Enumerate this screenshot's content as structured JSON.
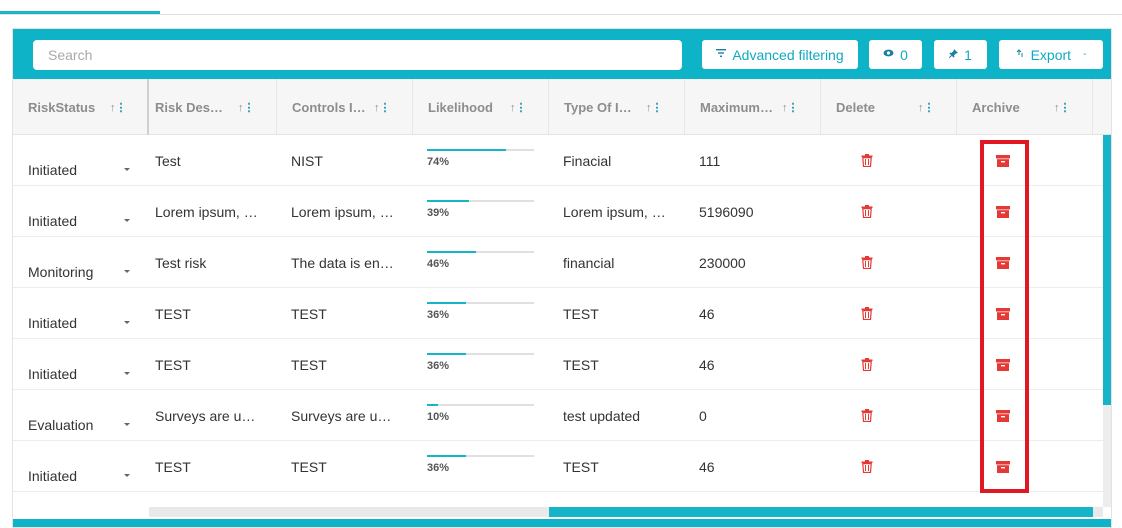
{
  "search": {
    "placeholder": "Search",
    "value": ""
  },
  "toolbar": {
    "advanced_filtering": "Advanced filtering",
    "visible_count": "0",
    "pinned_count": "1",
    "export_label": "Export",
    "icons": {
      "filter": "filter-icon",
      "eye": "eye-icon",
      "pin": "pin-icon",
      "export": "export-icon",
      "dropdown": "chevron-down-icon"
    }
  },
  "columns": [
    {
      "label": "RiskStatus"
    },
    {
      "label": "Risk Des…"
    },
    {
      "label": "Controls I…"
    },
    {
      "label": "Likelihood"
    },
    {
      "label": "Type Of I…"
    },
    {
      "label": "Maximum…"
    },
    {
      "label": "Delete"
    },
    {
      "label": "Archive"
    }
  ],
  "rows": [
    {
      "status": "Initiated",
      "description": "Test",
      "controls": "NIST",
      "likelihood": 74,
      "likelihood_label": "74%",
      "type": "Finacial",
      "maximum": "111"
    },
    {
      "status": "Initiated",
      "description": "Lorem ipsum, …",
      "controls": "Lorem ipsum, …",
      "likelihood": 39,
      "likelihood_label": "39%",
      "type": "Lorem ipsum, …",
      "maximum": "5196090"
    },
    {
      "status": "Monitoring",
      "description": "Test risk",
      "controls": "The data is en…",
      "likelihood": 46,
      "likelihood_label": "46%",
      "type": "financial",
      "maximum": "230000"
    },
    {
      "status": "Initiated",
      "description": "TEST",
      "controls": "TEST",
      "likelihood": 36,
      "likelihood_label": "36%",
      "type": "TEST",
      "maximum": "46"
    },
    {
      "status": "Initiated",
      "description": "TEST",
      "controls": "TEST",
      "likelihood": 36,
      "likelihood_label": "36%",
      "type": "TEST",
      "maximum": "46"
    },
    {
      "status": "Evaluation",
      "description": "Surveys are u…",
      "controls": "Surveys are u…",
      "likelihood": 10,
      "likelihood_label": "10%",
      "type": "test updated",
      "maximum": "0"
    },
    {
      "status": "Initiated",
      "description": "TEST",
      "controls": "TEST",
      "likelihood": 36,
      "likelihood_label": "36%",
      "type": "TEST",
      "maximum": "46"
    }
  ],
  "colors": {
    "accent": "#0eb3c7",
    "danger": "#e53935",
    "highlight": "#e01824"
  }
}
